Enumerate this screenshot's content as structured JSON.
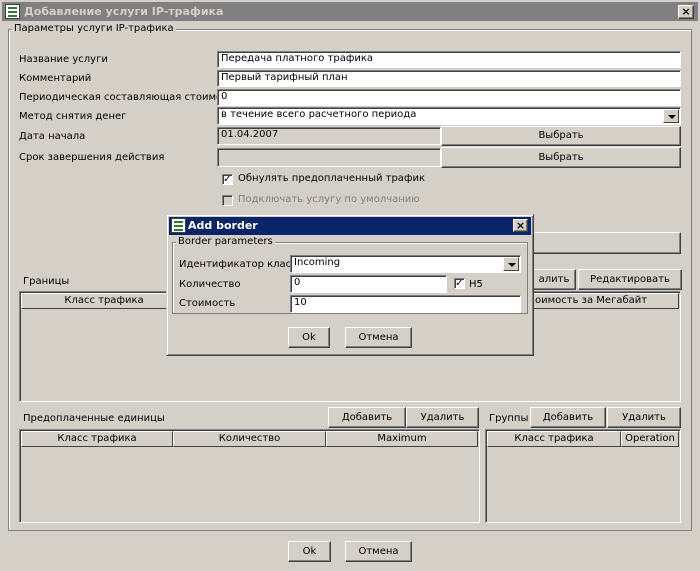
{
  "window": {
    "title": "Добавление услуги IP-трафика",
    "close_glyph": "×"
  },
  "params": {
    "legend": "Параметры услуги IP-трафика",
    "name_label": "Название услуги",
    "name_value": "Передача платного трафика",
    "comment_label": "Комментарий",
    "comment_value": "Первый тарифный план",
    "periodic_label": "Периодическая составляющая стоимости",
    "periodic_value": "0",
    "method_label": "Метод снятия денег",
    "method_value": "в течение всего расчетного периода",
    "start_label": "Дата начала",
    "start_value": "01.04.2007",
    "end_label": "Срок завершения действия",
    "end_value": "",
    "choose_label": "Выбрать",
    "reset_traffic_label": "Обнулять предоплаченный трафик",
    "reset_traffic_checked": true,
    "default_connect_label": "Подключать услугу по умолчанию",
    "check_glyph": "✓"
  },
  "borders": {
    "label": "Границы",
    "delete_partial": "алить",
    "edit_label": "Редактировать",
    "col_class": "Класс трафика",
    "col_cost_partial": "оимость за Мегабайт"
  },
  "prepaid": {
    "label": "Предоплаченные единицы",
    "add_label": "Добавить",
    "delete_label": "Удалить",
    "col_class": "Класс трафика",
    "col_quantity": "Количество",
    "col_max": "Maximum"
  },
  "groups": {
    "label": "Группы",
    "add_label": "Добавить",
    "delete_label": "Удалить",
    "col_class": "Класс трафика",
    "col_operation": "Operation"
  },
  "footer": {
    "ok_label": "Ok",
    "cancel_label": "Отмена"
  },
  "dialog": {
    "title": "Add border",
    "legend": "Border parameters",
    "class_id_label": "Идентификатор класса",
    "class_id_value": "Incoming",
    "quantity_label": "Количество",
    "quantity_value": "0",
    "h5_label": "H5",
    "h5_checked": true,
    "cost_label": "Стоимость",
    "cost_value": "10",
    "ok_label": "Ok",
    "cancel_label": "Отмена",
    "close_glyph": "×"
  },
  "colors": {
    "title_active": "#0a246a",
    "title_inactive": "#808080",
    "face": "#d4d0c8"
  }
}
